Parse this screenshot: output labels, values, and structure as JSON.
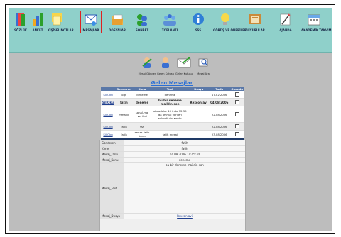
{
  "toolbar": {
    "items": [
      {
        "label": "SÖZLÜK",
        "icon": "dictionary-icon"
      },
      {
        "label": "ANKET",
        "icon": "poll-icon"
      },
      {
        "label": "KİŞİSEL NOTLAR",
        "icon": "notes-icon"
      },
      {
        "label": "MESAJLAR",
        "icon": "messages-icon"
      },
      {
        "label": "DOSYALAR",
        "icon": "files-icon"
      },
      {
        "label": "SOHBET",
        "icon": "chat-icon"
      },
      {
        "label": "TOPLANTI",
        "icon": "meeting-icon"
      },
      {
        "label": "SSS",
        "icon": "faq-icon"
      },
      {
        "label": "GÖRÜŞ VE ÖNERİLER",
        "icon": "suggestions-icon"
      },
      {
        "label": "DUYURULAR",
        "icon": "announcements-icon"
      },
      {
        "label": "AJANDA",
        "icon": "agenda-icon"
      },
      {
        "label": "AKADEMİK TAKVİM",
        "icon": "calendar-icon"
      }
    ]
  },
  "subnav": {
    "send": "Mesaj Gönder",
    "inbox": "Gelen Kutusu",
    "inbox2": "Gelen Kutusu",
    "search": "Mesaj Ara"
  },
  "inbox": {
    "title": "Gelen Mesajlar",
    "headers": [
      "Gonderen",
      "Konu",
      "Text",
      "Dosya",
      "Tarih",
      "Okundu"
    ],
    "rows": [
      {
        "del": "Sil Oku",
        "sender": "ogr",
        "subject": "deneme",
        "text": "deneme",
        "file": "",
        "date": "17.02.2006"
      },
      {
        "del": "Sil Oku",
        "sender": "fatih",
        "subject": "deneme",
        "text": "bu bir deneme maildir. son",
        "file": "Rexcon.avi",
        "date": "04.08.2006"
      },
      {
        "del": "Sil Oku",
        "sender": "mmahir",
        "subject": "sanal-mal verileri",
        "text": "ahvadalar 10 inda 12:59 da ofsmal verileri sohbetimiz vardır.",
        "file": "",
        "date": "22.08.2006"
      },
      {
        "del": "Sil Oku",
        "sender": "fatih",
        "subject": "sss",
        "text": "",
        "file": "",
        "date": "22.08.2006"
      },
      {
        "del": "Sil Oku",
        "sender": "fatih",
        "subject": "sedas fatih konu",
        "text": "fatih mesaj",
        "file": "",
        "date": "23.08.2006"
      }
    ],
    "pager": "1 2"
  },
  "detail": {
    "rows": [
      {
        "key": "Gonderen",
        "value": "fatih"
      },
      {
        "key": "Kime",
        "value": "fatih"
      },
      {
        "key": "Mesaj_Tarih",
        "value": "04.08.2006 14:45:30"
      },
      {
        "key": "Mesaj_Konu",
        "value": "deneme"
      },
      {
        "key": "Mesaj_Text",
        "value": "bu bir deneme maildir. son"
      },
      {
        "key": "Mesaj_Dosya",
        "value": "Rexcon.avi"
      }
    ]
  }
}
